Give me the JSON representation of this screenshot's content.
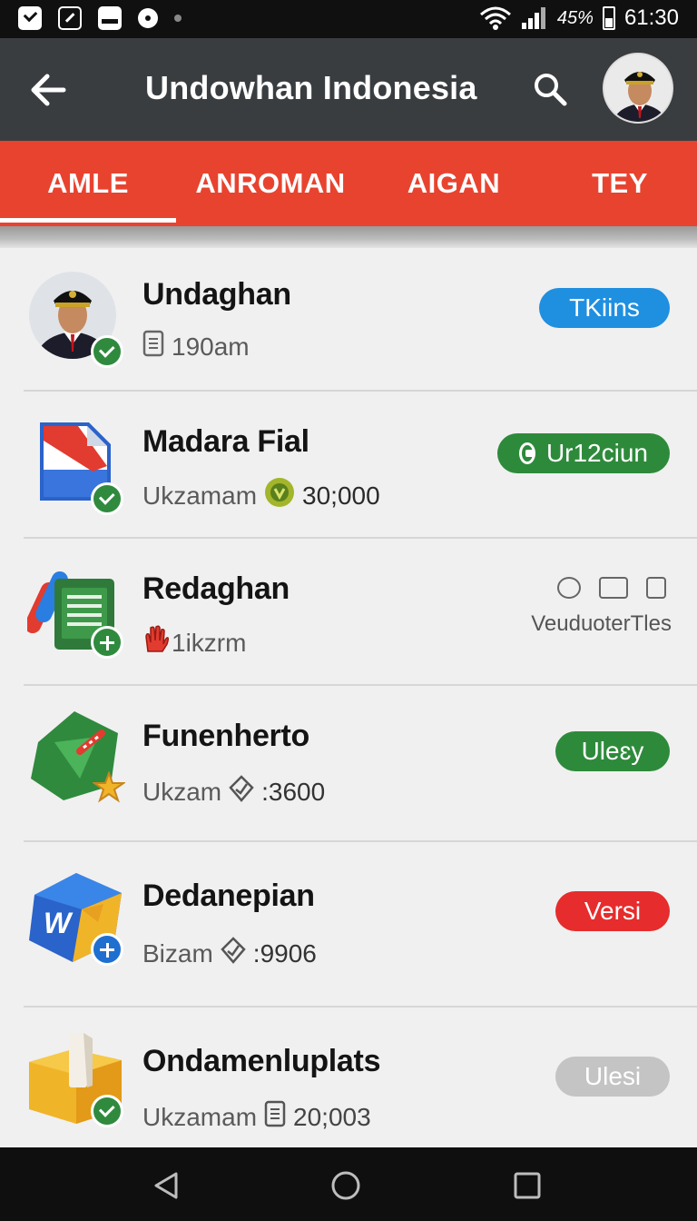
{
  "status_bar": {
    "battery": "45%",
    "time": "61:30",
    "left_icons": [
      "check-icon",
      "edit-icon",
      "box-icon",
      "record-icon",
      "dot-icon"
    ],
    "right_icons": [
      "wifi-icon",
      "signal-icon",
      "battery-icon"
    ]
  },
  "app_bar": {
    "title": "Undowhan Indonesia",
    "back_icon": "arrow-left-icon",
    "search_icon": "search-icon",
    "avatar": "profile-avatar"
  },
  "tabs": [
    {
      "label": "AMLE",
      "selected": true
    },
    {
      "label": "ANROMAN",
      "selected": false
    },
    {
      "label": "AIGAN",
      "selected": false
    },
    {
      "label": "TEY",
      "selected": false
    }
  ],
  "items": [
    {
      "name": "Undaghan",
      "meta_prefix": "",
      "meta_value": "190am",
      "meta_icon": "document-icon",
      "action": "TKiins",
      "action_color": "#1f8fe0",
      "badge": "check"
    },
    {
      "name": "Madara Fial",
      "meta_prefix": "Ukzamam",
      "meta_value": "30;000",
      "meta_icon": "green-coin-icon",
      "action": "Ur12ciun",
      "action_color": "#2e8a3b",
      "badge": "check"
    },
    {
      "name": "Redaghan",
      "meta_prefix": "",
      "meta_value": "1ikzrm",
      "meta_icon": "hand-icon",
      "action": "VeuduoterTles",
      "action_color": "#555555",
      "badge": "plus"
    },
    {
      "name": "Funenherto",
      "meta_prefix": "Ukzam",
      "meta_value": ":3600",
      "meta_icon": "shield-icon",
      "action": "Uleɛy",
      "action_color": "#2e8a3b",
      "badge": "star"
    },
    {
      "name": "Dedanepian",
      "meta_prefix": "Bizam",
      "meta_value": ":9906",
      "meta_icon": "shield-icon",
      "action": "Versi",
      "action_color": "#e62c2c",
      "badge": "plus"
    },
    {
      "name": "Ondamenluplats",
      "meta_prefix": "Ukzamam",
      "meta_value": "20;003",
      "meta_icon": "document-icon",
      "action": "Ulesi",
      "action_color": "#c4c4c4",
      "badge": "check"
    }
  ],
  "nav_bar": [
    "back-triangle-icon",
    "home-circle-icon",
    "recents-square-icon"
  ]
}
